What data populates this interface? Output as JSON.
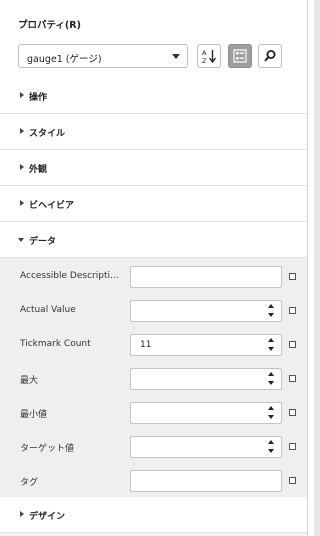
{
  "panel": {
    "title": "プロパティ(R)",
    "selector_value": "gauge1 (ゲージ)"
  },
  "toolbar": {
    "sort_icon": "sort-az-icon",
    "categorized_icon": "categorized-icon",
    "search_icon": "search-icon"
  },
  "sections": {
    "operations": "操作",
    "style": "スタイル",
    "appearance": "外観",
    "behavior": "ビヘイビア",
    "data": "データ",
    "design": "デザイン"
  },
  "properties": [
    {
      "label": "Accessible Descripti...",
      "value": "",
      "spinner": false
    },
    {
      "label": "Actual Value",
      "value": "",
      "spinner": true
    },
    {
      "label": "Tickmark Count",
      "value": "11",
      "spinner": true
    },
    {
      "label": "最大",
      "value": "",
      "spinner": true
    },
    {
      "label": "最小値",
      "value": "",
      "spinner": true
    },
    {
      "label": "ターゲット値",
      "value": "",
      "spinner": true
    },
    {
      "label": "タグ",
      "value": "",
      "spinner": false
    }
  ]
}
